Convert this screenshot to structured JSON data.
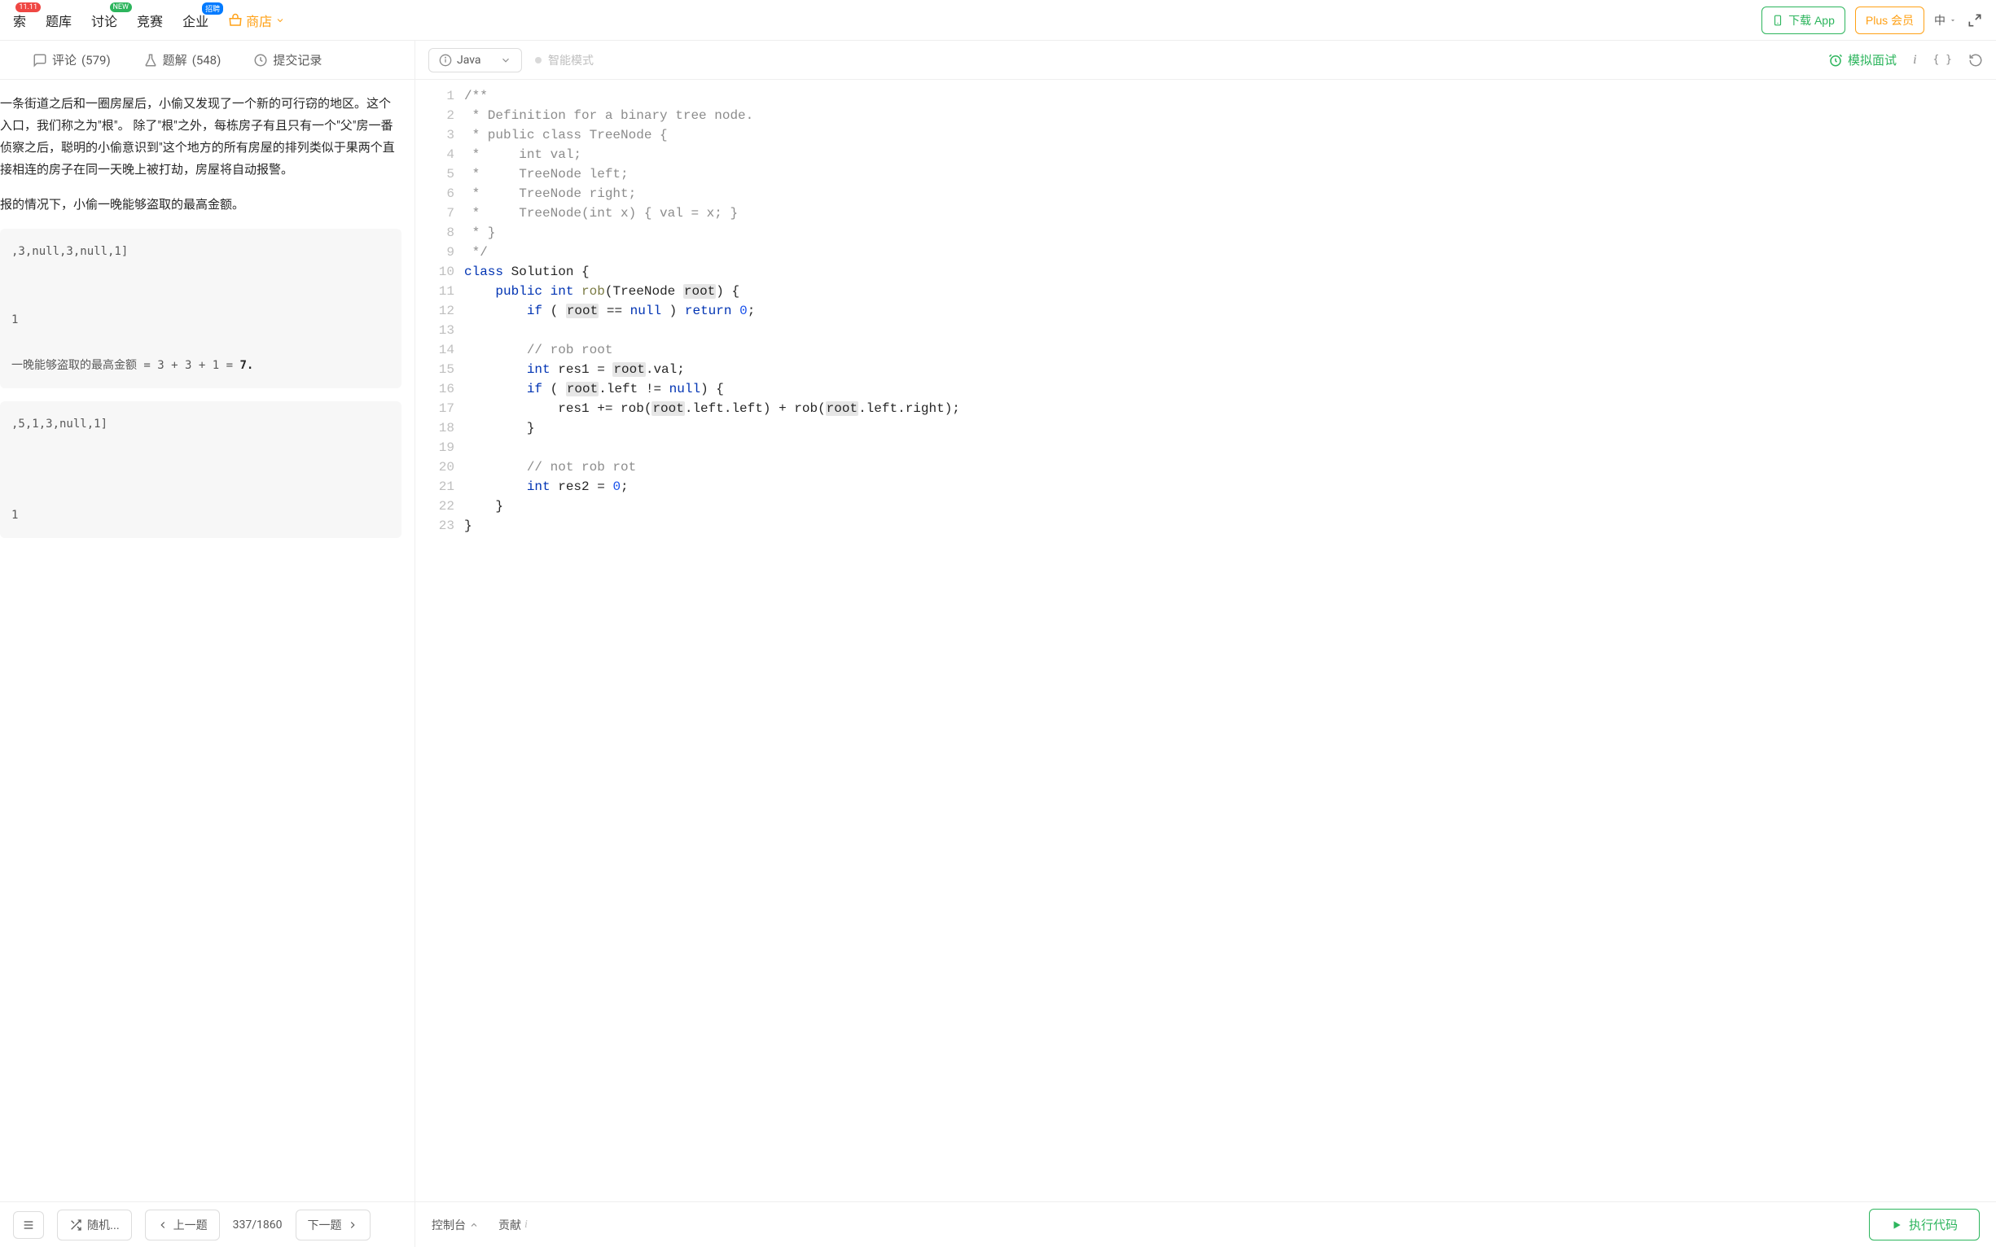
{
  "topnav": {
    "items": [
      {
        "label": "索",
        "badge": "11.11",
        "badgeClass": "badge-red"
      },
      {
        "label": "题库"
      },
      {
        "label": "讨论",
        "badge": "NEW",
        "badgeClass": "badge-green"
      },
      {
        "label": "竞赛"
      },
      {
        "label": "企业",
        "badge": "招聘",
        "badgeClass": "badge-blue"
      }
    ],
    "store": "商店",
    "download": "下载 App",
    "plus": "Plus 会员",
    "localeLabel": "中"
  },
  "tabs": {
    "comments": {
      "label": "评论",
      "count": "(579)"
    },
    "solutions": {
      "label": "题解",
      "count": "(548)"
    },
    "submissions": {
      "label": "提交记录"
    }
  },
  "problem": {
    "p1": "一条街道之后和一圈房屋后，小偷又发现了一个新的可行窃的地区。这个入口，我们称之为\"根\"。 除了\"根\"之外，每栋房子有且只有一个\"父\"房一番侦察之后，聪明的小偷意识到\"这个地方的所有房屋的排列类似于果两个直接相连的房子在同一天晚上被打劫，房屋将自动报警。",
    "p2": "报的情况下，小偷一晚能够盗取的最高金额。",
    "ex1_input": ",3,null,3,null,1]",
    "ex1_mid": "1",
    "ex1_out_pre": "一晚能够盗取的最高金额 = 3 + 3 + 1 = ",
    "ex1_out_val": "7.",
    "ex2_input": ",5,1,3,null,1]",
    "ex2_mid": "1"
  },
  "footer": {
    "shuffle": "随机...",
    "prev": "上一题",
    "page": "337/1860",
    "next": "下一题"
  },
  "editor": {
    "language": "Java",
    "smartMode": "智能模式",
    "mockInterview": "模拟面试",
    "console": "控制台",
    "contribute": "贡献",
    "run": "执行代码"
  },
  "code": {
    "lines": [
      {
        "n": 1,
        "html": "<span class='tok-comment'>/**</span>"
      },
      {
        "n": 2,
        "html": "<span class='tok-comment'> * Definition for a binary tree node.</span>"
      },
      {
        "n": 3,
        "html": "<span class='tok-comment'> * public class TreeNode {</span>"
      },
      {
        "n": 4,
        "html": "<span class='tok-comment'> *     int val;</span>"
      },
      {
        "n": 5,
        "html": "<span class='tok-comment'> *     TreeNode left;</span>"
      },
      {
        "n": 6,
        "html": "<span class='tok-comment'> *     TreeNode right;</span>"
      },
      {
        "n": 7,
        "html": "<span class='tok-comment'> *     TreeNode(int x) { val = x; }</span>"
      },
      {
        "n": 8,
        "html": "<span class='tok-comment'> * }</span>"
      },
      {
        "n": 9,
        "html": "<span class='tok-comment'> */</span>"
      },
      {
        "n": 10,
        "html": "<span class='tok-keyword'>class</span> <span class='tok-ident'>Solution</span> {"
      },
      {
        "n": 11,
        "html": "    <span class='tok-keyword'>public</span> <span class='tok-type'>int</span> <span class='tok-method'>rob</span>(TreeNode <span class='hl-root'>root</span>) {"
      },
      {
        "n": 12,
        "html": "        <span class='tok-keyword'>if</span> ( <span class='hl-root'>root</span> == <span class='tok-keyword'>null</span> ) <span class='tok-keyword'>return</span> <span class='tok-num'>0</span>;"
      },
      {
        "n": 13,
        "html": ""
      },
      {
        "n": 14,
        "html": "        <span class='tok-comment'>// rob root</span>"
      },
      {
        "n": 15,
        "html": "        <span class='tok-type'>int</span> res1 = <span class='hl-root'>root</span>.val;<span class='cursor-mark'>  </span>"
      },
      {
        "n": 16,
        "html": "        <span class='tok-keyword'>if</span> ( <span class='hl-root'>root</span>.left != <span class='tok-keyword'>null</span>)<span class='cursor-mark'> </span>{"
      },
      {
        "n": 17,
        "html": "            res1 += rob(<span class='hl-root'>root</span>.left.left) + rob(<span class='hl-root'>root</span>.left.right);"
      },
      {
        "n": 18,
        "html": "        }"
      },
      {
        "n": 19,
        "html": ""
      },
      {
        "n": 20,
        "html": "        <span class='tok-comment'>// not rob rot</span>"
      },
      {
        "n": 21,
        "html": "        <span class='tok-type'>int</span> res2 = <span class='tok-num'>0</span>;"
      },
      {
        "n": 22,
        "html": "    }"
      },
      {
        "n": 23,
        "html": "}"
      }
    ]
  }
}
